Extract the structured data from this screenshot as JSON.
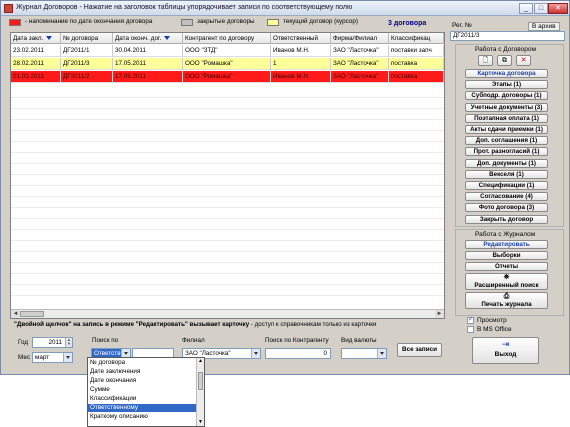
{
  "window": {
    "title": "Журнал Договоров  -  Нажатие на заголовок таблицы упорядочивает записи по соответствующему полю"
  },
  "legend": {
    "items": [
      {
        "label": "- напоминание по дате окончания договора",
        "color": "#ff1a1a"
      },
      {
        "label": "закрытые договоры",
        "color": "#c0c0c0"
      },
      {
        "label": "текущий договор (курсор)",
        "color": "#ffff99"
      }
    ],
    "count": "3 договора"
  },
  "table": {
    "columns": [
      "Дата закл.",
      "№ договора",
      "Дата оконч. дог.",
      "Контрагент по договору",
      "Ответственный",
      "Фирма/Филиал",
      "Классификац"
    ],
    "rows": [
      {
        "date": "23.02.2011",
        "num": "ДГ2011/1",
        "end": "30.04.2011",
        "contractor": "ООО \"ЗТД\"",
        "resp": "Иванов М.Н.",
        "firm": "ЗАО \"Ласточка\"",
        "cls": "поставки запч",
        "style": "white"
      },
      {
        "date": "28.02.2011",
        "num": "ДГ2011/3",
        "end": "17.05.2011",
        "contractor": "ООО \"Ромашка\"",
        "resp": "1",
        "firm": "ЗАО \"Ласточка\"",
        "cls": "поставка",
        "style": "yellow"
      },
      {
        "date": "01.03.2011",
        "num": "ДГ2011/2",
        "end": "17.05.2011",
        "contractor": "ООО \"Ромашка\"",
        "resp": "Иванов М.Н.",
        "firm": "ЗАО \"Ласточка\"",
        "cls": "поставка",
        "style": "red"
      }
    ]
  },
  "hint": {
    "part1": "\"Двойной щелчок\" на запись в режиме \"Редактировать\" вызывает карточку",
    "part2": "  -  доступ к справочникам только из карточки"
  },
  "filters": {
    "year_label": "Год",
    "year_value": "2011",
    "month_label": "Мес",
    "month_value": "март",
    "search_by_label": "Поиск по",
    "search_by_value": "Ответств",
    "filial_label": "Филиал",
    "filial_value": "ЗАО \"Ласточка\"",
    "contractor_search_label": "Поиск по Контрагенту",
    "contractor_search_value": "0",
    "currency_label": "Вид валюты",
    "all_records_button": "Все записи"
  },
  "search_dropdown": {
    "options": [
      "№ договора",
      "Дате заключения",
      "Дате окончания",
      "Сумме",
      "Классификации",
      "Ответственному",
      "Краткому описанию"
    ],
    "selected_index": 5
  },
  "right_panel": {
    "reg_label": "Рег. №",
    "archive_label": "В архив",
    "reg_value": "ДГ2011/3",
    "work_contracts_label": "Работа с Договором",
    "contract_buttons": [
      "Карточка договора",
      "Этапы (1)",
      "Субподр. договоры (1)",
      "Учетные документы (3)",
      "Поэтапная оплата (1)",
      "Акты сдачи приемки (1)",
      "Доп. соглашения (1)",
      "Прот. разногласий (1)",
      "Доп. документы (1)",
      "Векселя (1)",
      "Спецификации (1)",
      "Согласование (4)",
      "Фото договора (3)",
      "Закрыть договор"
    ],
    "work_journal_label": "Работа с Журналом",
    "journal_buttons": [
      "Редактировать",
      "Выборки",
      "Отчеты"
    ],
    "ext_search": "Расширенный поиск",
    "print_journal": "Печать журнала",
    "preview_label": "Просмотр",
    "msoffice_label": "В MS Office",
    "exit_button": "Выход"
  }
}
